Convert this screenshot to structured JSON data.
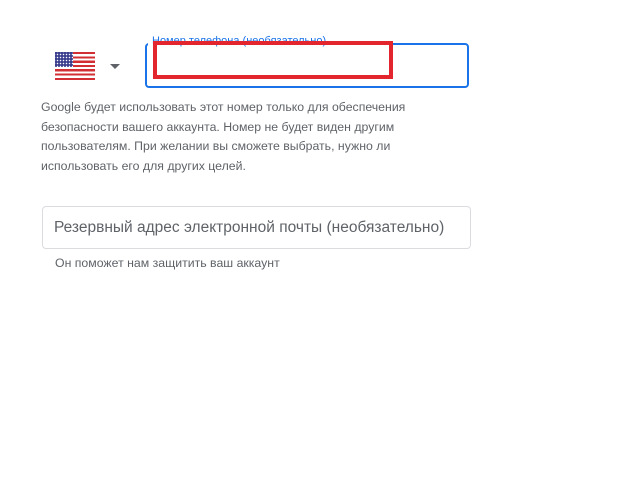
{
  "phone": {
    "country_flag": "us-flag-icon",
    "label": "Номер телефона (необязательно)",
    "value": "",
    "hint": "Google будет использовать этот номер только для обеспечения безопасности вашего аккаунта. Номер не будет виден другим пользователям. При желании вы сможете выбрать, нужно ли использовать его для других целей.",
    "focus_color": "#1a73e8",
    "redaction_color": "#e3262e"
  },
  "recovery_email": {
    "placeholder": "Резервный адрес электронной почты (необязательно)",
    "value": "",
    "hint": "Он поможет нам защитить ваш аккаунт"
  }
}
